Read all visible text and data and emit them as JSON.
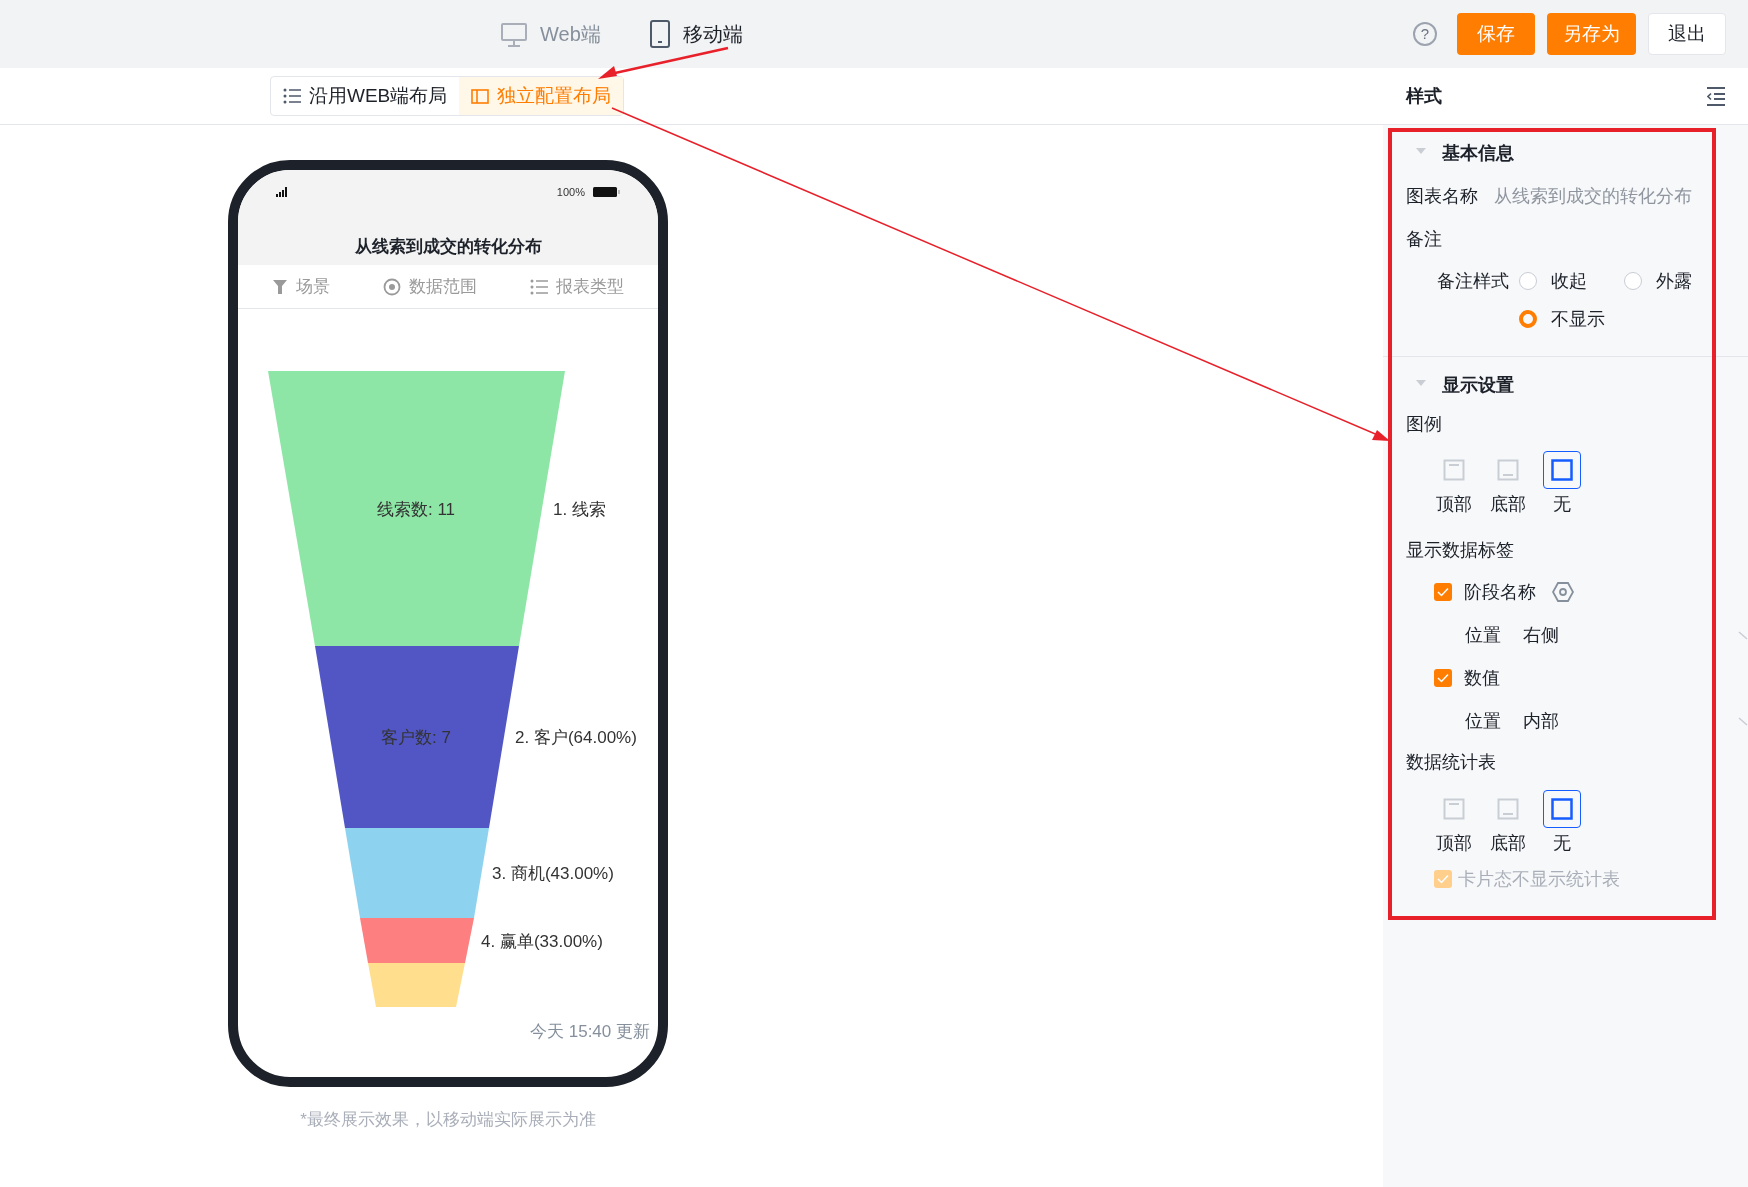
{
  "topbar": {
    "help": "?",
    "platforms": [
      {
        "kind": "web",
        "label": "Web端",
        "selected": false
      },
      {
        "kind": "mobile",
        "label": "移动端",
        "selected": true
      }
    ],
    "buttons": [
      {
        "kind": "primary",
        "label": "保存"
      },
      {
        "kind": "primary",
        "label": "另存为"
      },
      {
        "kind": "plain",
        "label": "退出"
      }
    ]
  },
  "layout_toggle": [
    {
      "kind": "list",
      "label": "沿用WEB端布局",
      "selected": false
    },
    {
      "kind": "panel",
      "label": "独立配置布局",
      "selected": true
    }
  ],
  "phone": {
    "status": {
      "battery": "100%"
    },
    "title": "从线索到成交的转化分布",
    "tabs": [
      {
        "kind": "filter",
        "label": "场景"
      },
      {
        "kind": "target",
        "label": "数据范围"
      },
      {
        "kind": "list",
        "label": "报表类型"
      }
    ],
    "funnel": [
      {
        "value_label": "线索数: 11",
        "name_label": "1. 线索",
        "color": "#8ee6a6"
      },
      {
        "value_label": "客户数: 7",
        "name_label": "2. 客户(64.00%)",
        "color": "#5156c4"
      },
      {
        "name_label": "3. 商机(43.00%)",
        "color": "#8dd3ef"
      },
      {
        "name_label": "4. 赢单(33.00%)",
        "color": "#fe7f7f"
      },
      {
        "color": "#ffdf8d"
      }
    ],
    "updated": "今天 15:40 更新"
  },
  "caption": "*最终展示效果，以移动端实际展示为准",
  "panel": {
    "title": "样式",
    "basic": {
      "title": "基本信息",
      "expanded": true,
      "chart_name_label": "图表名称",
      "chart_name_placeholder": "从线索到成交的转化分布",
      "note_label": "备注",
      "note_style_label": "备注样式",
      "note_styles": [
        {
          "label": "收起",
          "selected": false
        },
        {
          "label": "外露",
          "selected": false
        },
        {
          "label": "不显示",
          "selected": true
        }
      ]
    },
    "display": {
      "title": "显示设置",
      "expanded": true,
      "legend_label": "图例",
      "legend": [
        {
          "kind": "top",
          "label": "顶部",
          "selected": false
        },
        {
          "kind": "bottom",
          "label": "底部",
          "selected": false
        },
        {
          "kind": "none",
          "label": "无",
          "selected": true
        }
      ],
      "data_labels_label": "显示数据标签",
      "data_labels": [
        {
          "label": "阶段名称",
          "checked": true,
          "settings": true,
          "position_label": "位置",
          "position": "右侧"
        },
        {
          "label": "数值",
          "checked": true,
          "settings": false,
          "position_label": "位置",
          "position": "内部"
        }
      ],
      "table_label": "数据统计表",
      "table": [
        {
          "kind": "top",
          "label": "顶部",
          "selected": false
        },
        {
          "kind": "bottom",
          "label": "底部",
          "selected": false
        },
        {
          "kind": "none",
          "label": "无",
          "selected": true
        }
      ],
      "card_hide": {
        "label": "卡片态不显示统计表",
        "checked": true,
        "disabled": true
      }
    }
  }
}
